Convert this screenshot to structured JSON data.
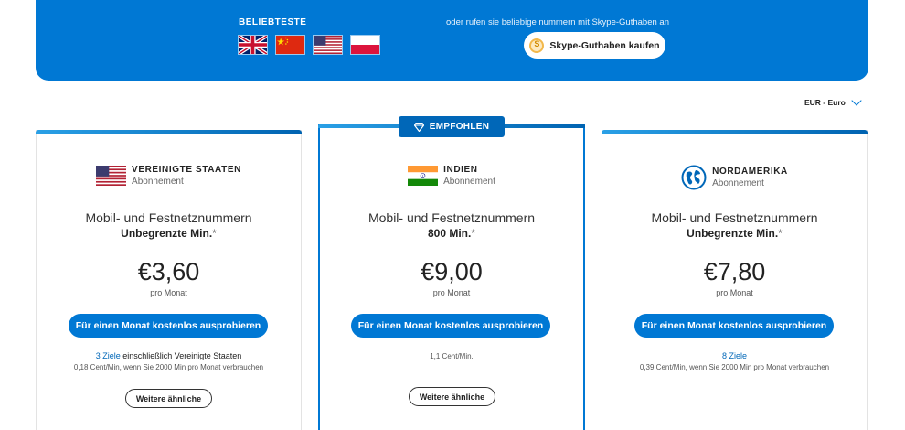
{
  "banner": {
    "popular_title": "BELIEBTESTE",
    "flags": [
      "uk-flag",
      "china-flag",
      "usa-flag",
      "poland-flag"
    ],
    "credit_text": "oder rufen sie beliebige nummern mit Skype-Guthaben an",
    "credit_button": "Skype-Guthaben kaufen",
    "color": "#0078d4"
  },
  "currency": {
    "label": "EUR - Euro"
  },
  "featured_badge": "EMPFOHLEN",
  "cards": [
    {
      "country": "VEREINIGTE STAATEN",
      "type": "Abonnement",
      "icon": "usa-flag",
      "desc": "Mobil- und Festnetznummern",
      "minutes": "Unbegrenzte Min.",
      "star": "*",
      "price": "€3,60",
      "per": "pro Monat",
      "try_label": "Für einen Monat kostenlos ausprobieren",
      "dest_link": "3 Ziele",
      "dest_text": " einschließlich Vereinigte Staaten",
      "rate": "0,18 Cent/Min, wenn Sie 2000 Min pro Monat verbrauchen",
      "more_label": "Weitere ähnliche"
    },
    {
      "country": "INDIEN",
      "type": "Abonnement",
      "icon": "india-flag",
      "desc": "Mobil- und Festnetznummern",
      "minutes": "800 Min.",
      "star": "*",
      "price": "€9,00",
      "per": "pro Monat",
      "try_label": "Für einen Monat kostenlos ausprobieren",
      "rate": "1,1 Cent/Min.",
      "more_label": "Weitere ähnliche"
    },
    {
      "country": "NORDAMERIKA",
      "type": "Abonnement",
      "icon": "globe-icon",
      "desc": "Mobil- und Festnetznummern",
      "minutes": "Unbegrenzte Min.",
      "star": "*",
      "price": "€7,80",
      "per": "pro Monat",
      "try_label": "Für einen Monat kostenlos ausprobieren",
      "dest_link": "8 Ziele",
      "rate": "0,39 Cent/Min, wenn Sie 2000 Min pro Monat verbrauchen"
    }
  ]
}
